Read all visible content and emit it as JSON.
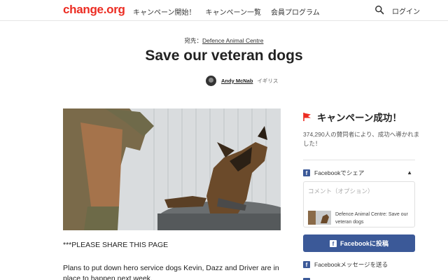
{
  "header": {
    "logo": "change.org",
    "nav": [
      "キャンペーン開始！",
      "キャンペーン一覧",
      "会員プログラム"
    ],
    "login_label": "ログイン"
  },
  "petition": {
    "target_prefix": "宛先：",
    "target_name": "Defence Animal Centre",
    "title": "Save our veteran dogs",
    "author_name": "Andy McNab",
    "author_location": "イギリス",
    "body_line1": "***PLEASE SHARE THIS PAGE",
    "body_line2": "Plans to put down hero service dogs Kevin, Dazz and Driver are in place to happen next week."
  },
  "sidebar": {
    "victory_label": "キャンペーン成功！",
    "signers_text": "374,290人の賛同者により、成功へ導かれました！",
    "facebook_share_label": "Facebookでシェア",
    "comment_placeholder": "コメント（オプション）",
    "preview_text": "Defence Animal Centre: Save our veteran dogs",
    "facebook_post_button": "Facebookに投稿",
    "facebook_message_label": "Facebookメッセージを送る"
  },
  "colors": {
    "brand": "#ec2c22",
    "facebook": "#3b5998"
  },
  "icons": {
    "search": "search-icon",
    "flag": "flag-icon",
    "facebook": "facebook-icon",
    "chevron": "chevron-up-icon"
  }
}
